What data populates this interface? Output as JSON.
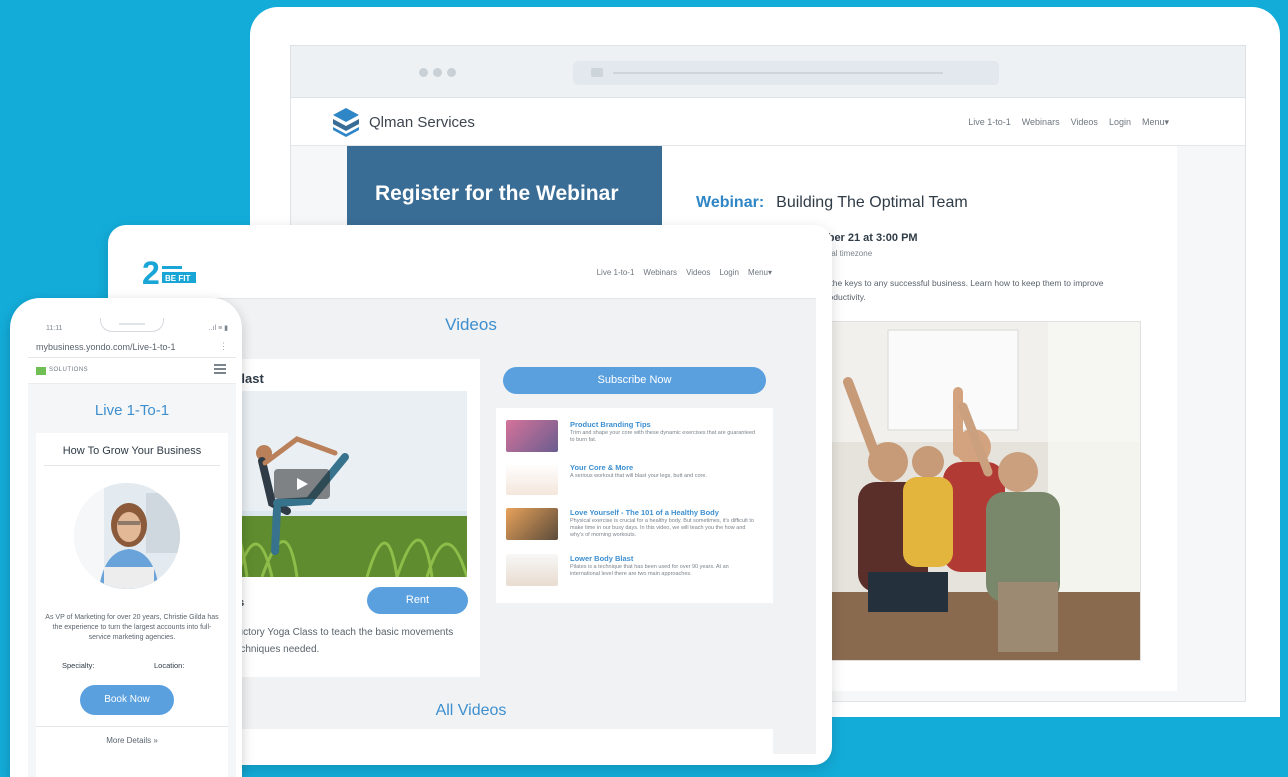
{
  "laptop": {
    "brand": "Qlman Services",
    "nav": [
      "Live 1-to-1",
      "Webinars",
      "Videos",
      "Login",
      "Menu▾"
    ],
    "register_title": "Register for the Webinar",
    "webinar_label": "Webinar:",
    "webinar_title": "Building The Optimal Team",
    "webinar_date": "nber 21 at 3:00 PM",
    "webinar_timezone": "local timezone",
    "webinar_description": "of the keys to any successful business. Learn how to keep them to improve productivity."
  },
  "tablet": {
    "logo_text": "2 BE FIT",
    "nav": [
      "Live 1-to-1",
      "Webinars",
      "Videos",
      "Login",
      "Menu▾"
    ],
    "page_title": "Videos",
    "video_card": {
      "title": "Blast",
      "days_label": "ys",
      "rent_label": "Rent",
      "description": "ductory Yoga Class to teach the basic movements techniques needed."
    },
    "subscribe_label": "Subscribe Now",
    "video_list": [
      {
        "title": "Product Branding Tips",
        "desc": "Trim and shape your core with these dynamic exercises that are guaranteed to burn fat."
      },
      {
        "title": "Your Core & More",
        "desc": "A serious workout that will blast your legs, butt and core."
      },
      {
        "title": "Love Yourself - The 101 of a Healthy Body",
        "desc": "Physical exercise is crucial for a healthy body. But sometimes, it's difficult to make time in our busy days. In this video, we will teach you the how and why's of morning workouts."
      },
      {
        "title": "Lower Body Blast",
        "desc": "Pilates is a technique that has been used for over 90 years. At an international level there are two main approaches."
      }
    ],
    "all_videos": "All Videos"
  },
  "phone": {
    "time": "11:11",
    "signal": "..ıl ≡ ▮",
    "url": "mybusiness.yondo.com/Live-1-to-1",
    "url_menu": "⋮",
    "brand": "SOLUTIONS",
    "page_title": "Live 1-To-1",
    "card_title": "How To Grow Your Business",
    "bio": "As VP of Marketing for over 20 years, Christie Gilda has the experience to turn the largest accounts into full-service marketing agencies.",
    "specialty_label": "Specialty:",
    "location_label": "Location:",
    "book_label": "Book Now",
    "more_details": "More Details »"
  },
  "colors": {
    "background": "#13acd9",
    "accent": "#5aa0df",
    "link": "#3d8fd0",
    "register_box": "#3a6d95"
  }
}
